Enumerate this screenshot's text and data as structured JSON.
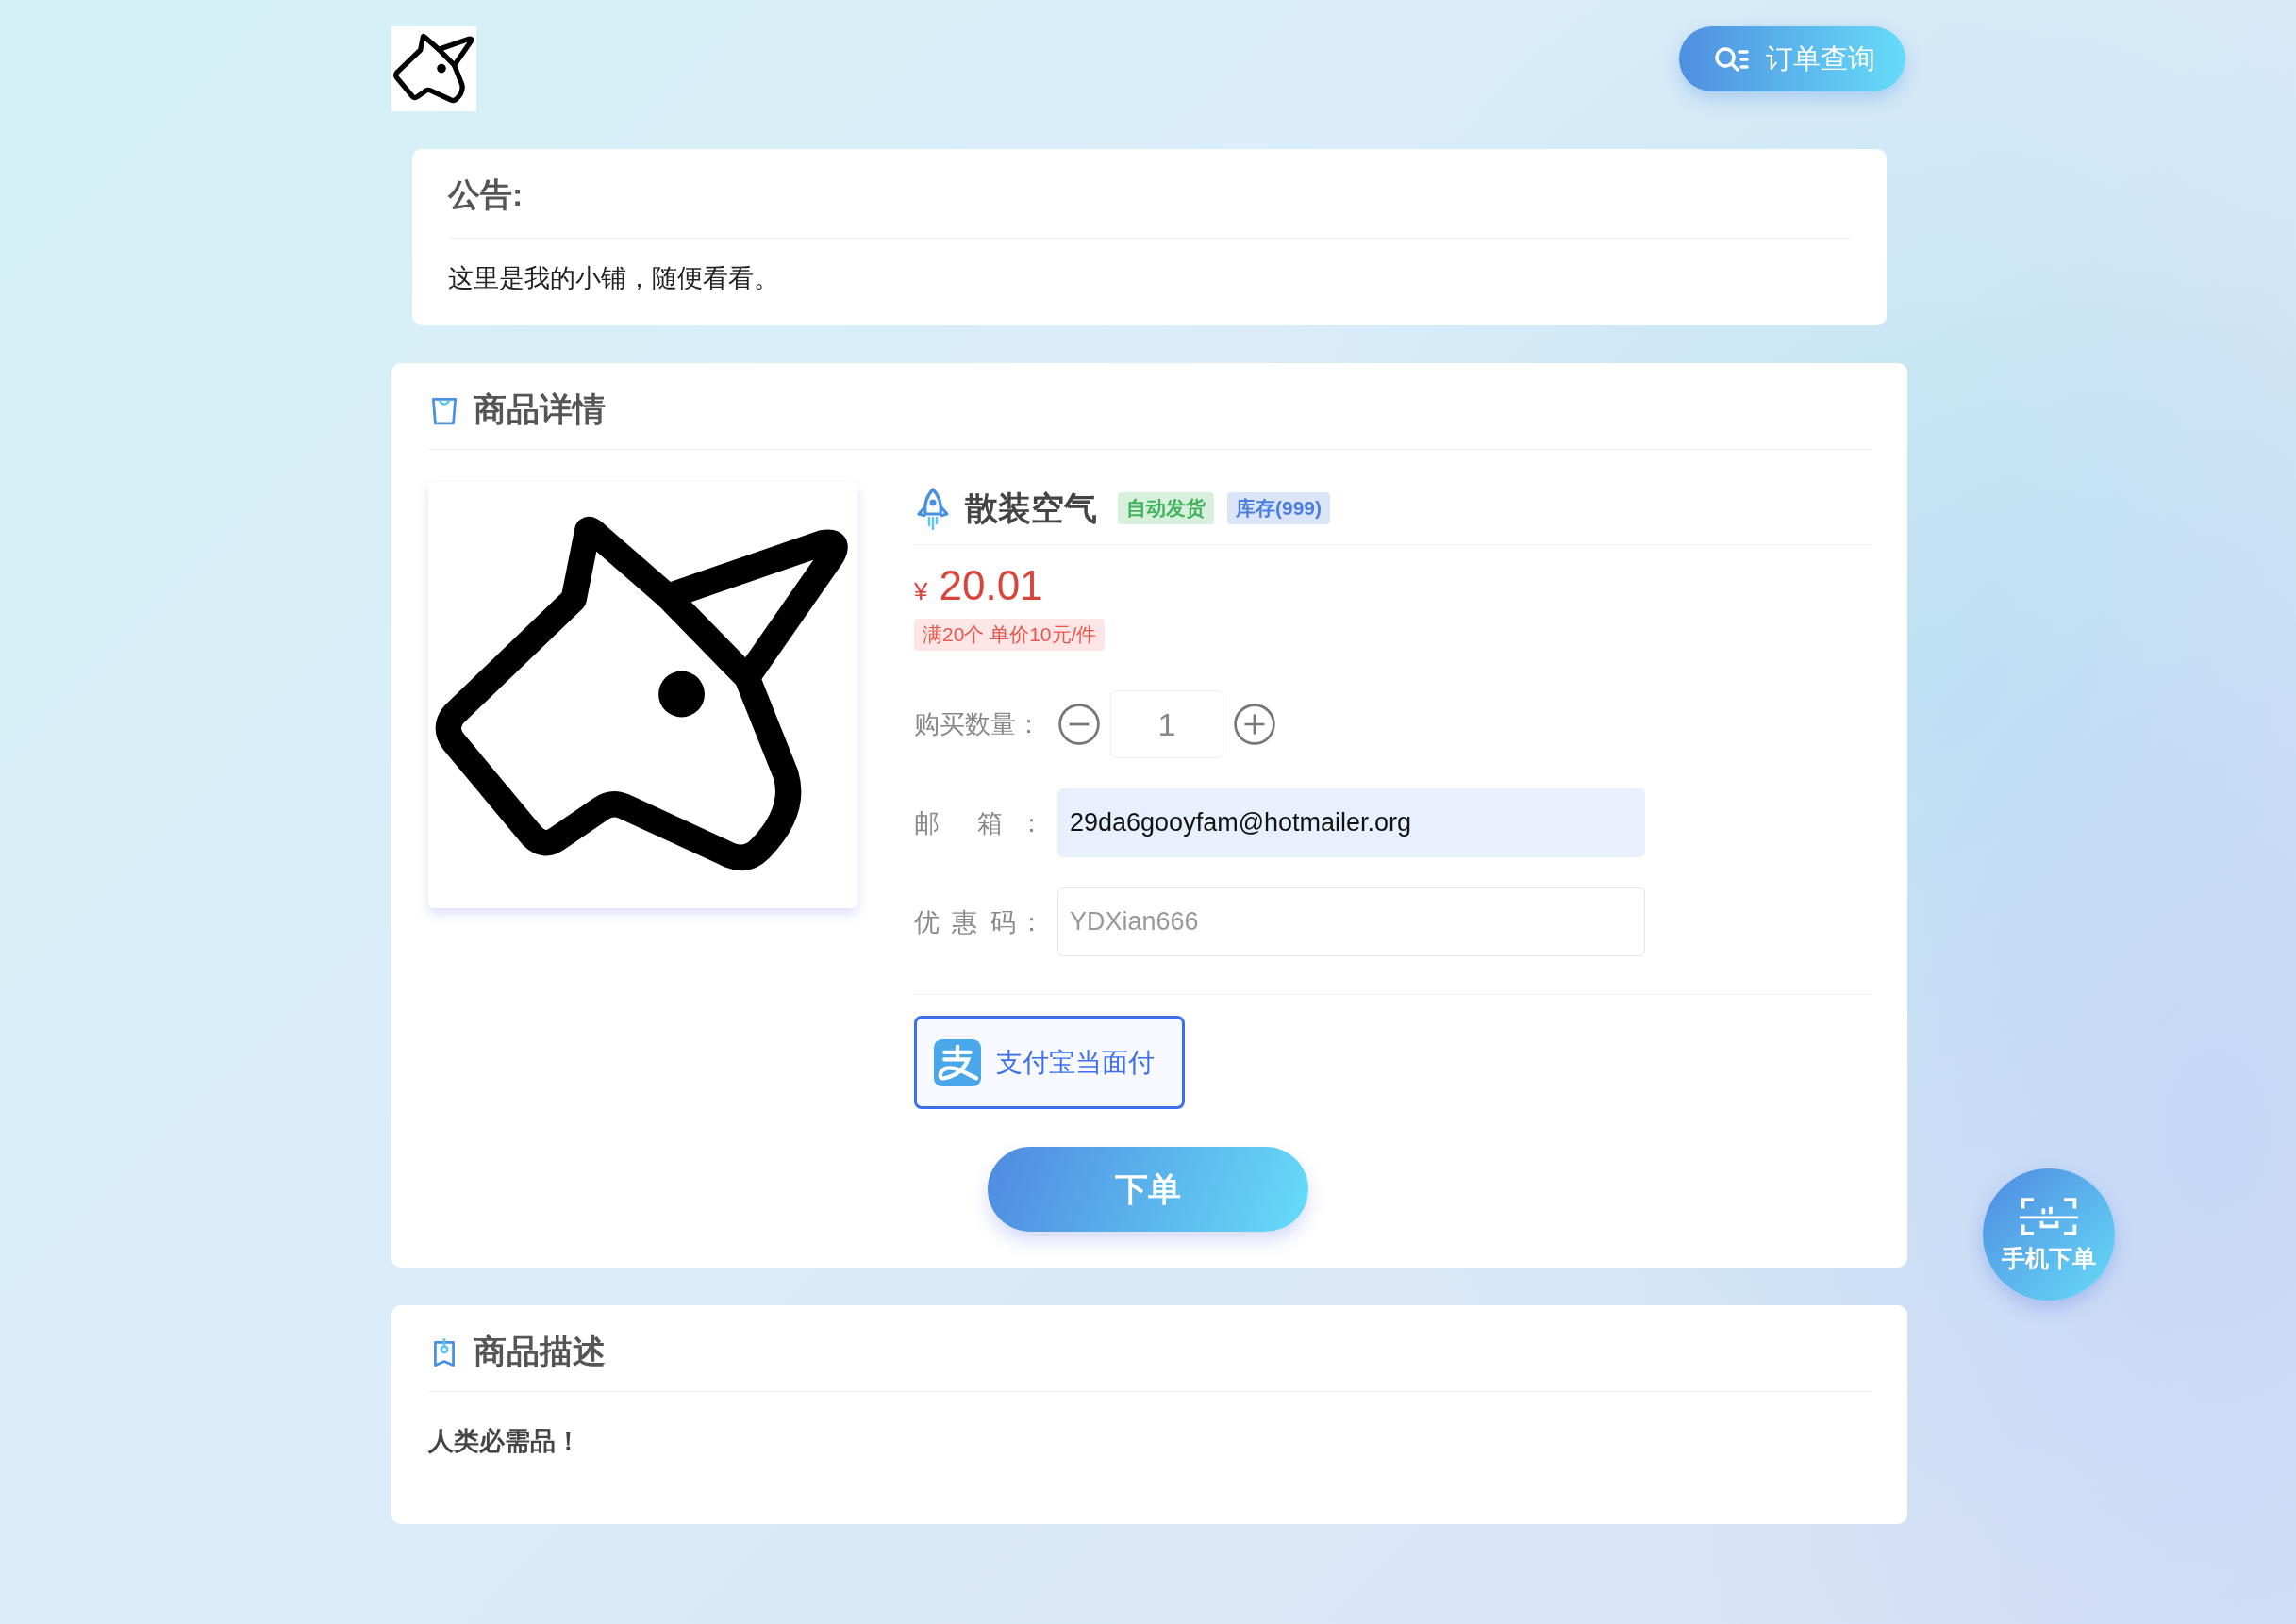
{
  "header": {
    "order_query_button": "订单查询"
  },
  "notice": {
    "title": "公告:",
    "text": "这里是我的小铺，随便看看。"
  },
  "product": {
    "section_title": "商品详情",
    "name": "散装空气",
    "tags": [
      {
        "label": "自动发货",
        "color": "#3fb45a"
      },
      {
        "label": "库存(999)",
        "color": "#4a7fde"
      }
    ],
    "currency": "¥",
    "price": "20.01",
    "promo": "满20个 单价10元/件",
    "quantity": {
      "label": "购买数量：",
      "value": "1"
    },
    "fields": [
      {
        "label": "邮 箱：",
        "value": "29da6gooyfam@hotmailer.org",
        "filled": true
      },
      {
        "label": "优 惠 码：",
        "placeholder": "YDXian666",
        "filled": false
      }
    ],
    "payment_methods": [
      {
        "label": "支付宝当面付",
        "selected": true
      }
    ],
    "submit_button": "下单"
  },
  "description": {
    "section_title": "商品描述",
    "text": "人类必需品！"
  },
  "floating_button": {
    "label": "手机下单"
  }
}
